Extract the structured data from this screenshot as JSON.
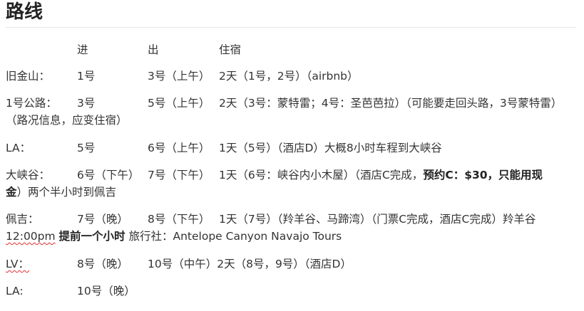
{
  "title": "路线",
  "header": {
    "col1": "进",
    "col2": "出",
    "col3": "住宿"
  },
  "rows": [
    {
      "place": "旧金山：",
      "in": "1号",
      "out": "3号（上午）",
      "stay": "2天（1号，2号）（airbnb）"
    },
    {
      "place": "1号公路：",
      "in": "3号",
      "out": "5号（上午）",
      "stay": "2天（3号：蒙特雷；4号：圣芭芭拉）（可能要走回头路，3号蒙特雷）",
      "wrap": "（路况信息，应变住宿）"
    },
    {
      "place": "LA：",
      "in": "5号",
      "out": "6号（上午）",
      "stay": "1天（5号）（酒店D）大概8小时车程到大峡谷"
    },
    {
      "place": "大峡谷：",
      "in": "6号（下午）",
      "out": "7号（下午）",
      "stay": "1天（6号：峡谷内小木屋）（酒店C完成，",
      "stay_bold": "预约C：$30，只能用现",
      "wrap_bold": "金",
      "wrap": "）两个半小时到佩吉"
    },
    {
      "place": "佩吉：",
      "in": "7号（晚）",
      "out": "8号（下午）",
      "stay": "1天（7号）（羚羊谷、马蹄湾）（门票C完成，酒店C完成）羚羊谷",
      "wrap_time": "12:00pm",
      "wrap_bold": "提前一个小时",
      "wrap": "旅行社：Antelope Canyon Navajo Tours"
    },
    {
      "place": "LV：",
      "in": "8号（晚）",
      "out": "10号（中午）2天（8号，9号）（酒店D）"
    },
    {
      "place": "LA:",
      "in": "10号（晚）"
    }
  ]
}
